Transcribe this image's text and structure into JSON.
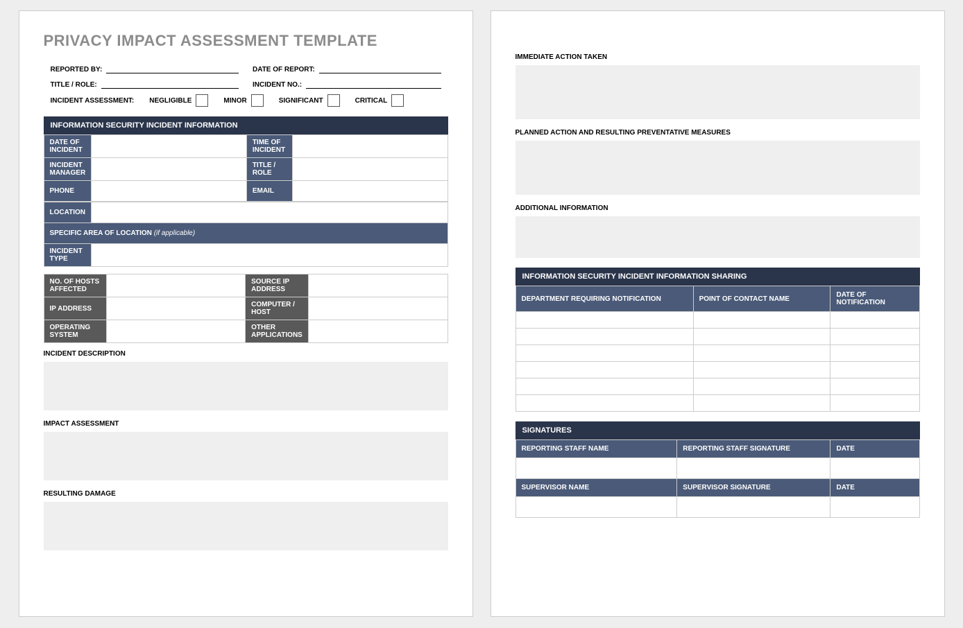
{
  "title": "PRIVACY IMPACT ASSESSMENT TEMPLATE",
  "header": {
    "reported_by": "REPORTED BY:",
    "date_of_report": "DATE OF REPORT:",
    "title_role": "TITLE / ROLE:",
    "incident_no": "INCIDENT NO.:",
    "assessment_label": "INCIDENT ASSESSMENT:",
    "levels": {
      "negligible": "NEGLIGIBLE",
      "minor": "MINOR",
      "significant": "SIGNIFICANT",
      "critical": "CRITICAL"
    }
  },
  "sections": {
    "info_sec": "INFORMATION SECURITY INCIDENT INFORMATION",
    "labels": {
      "date_of_incident": "DATE OF INCIDENT",
      "time_of_incident": "TIME OF INCIDENT",
      "incident_manager": "INCIDENT MANAGER",
      "title_role": "TITLE / ROLE",
      "phone": "PHONE",
      "email": "EMAIL",
      "location": "LOCATION",
      "specific_area": "SPECIFIC AREA OF LOCATION",
      "specific_area_note": "(if applicable)",
      "incident_type": "INCIDENT TYPE",
      "hosts_affected": "NO. OF HOSTS AFFECTED",
      "source_ip": "SOURCE IP ADDRESS",
      "ip_address": "IP ADDRESS",
      "computer_host": "COMPUTER / HOST",
      "os": "OPERATING SYSTEM",
      "other_apps": "OTHER APPLICATIONS"
    },
    "incident_description": "INCIDENT DESCRIPTION",
    "impact_assessment": "IMPACT ASSESSMENT",
    "resulting_damage": "RESULTING DAMAGE",
    "immediate_action": "IMMEDIATE ACTION TAKEN",
    "planned_action": "PLANNED ACTION AND RESULTING PREVENTATIVE MEASURES",
    "additional_info": "ADDITIONAL INFORMATION",
    "sharing_header": "INFORMATION SECURITY INCIDENT INFORMATION SHARING",
    "sharing_cols": {
      "dept": "DEPARTMENT REQUIRING NOTIFICATION",
      "contact": "POINT OF CONTACT NAME",
      "date": "DATE OF NOTIFICATION"
    },
    "signatures_header": "SIGNATURES",
    "sig": {
      "reporting_name": "REPORTING STAFF NAME",
      "reporting_sig": "REPORTING STAFF SIGNATURE",
      "date1": "DATE",
      "supervisor_name": "SUPERVISOR NAME",
      "supervisor_sig": "SUPERVISOR SIGNATURE",
      "date2": "DATE"
    }
  }
}
